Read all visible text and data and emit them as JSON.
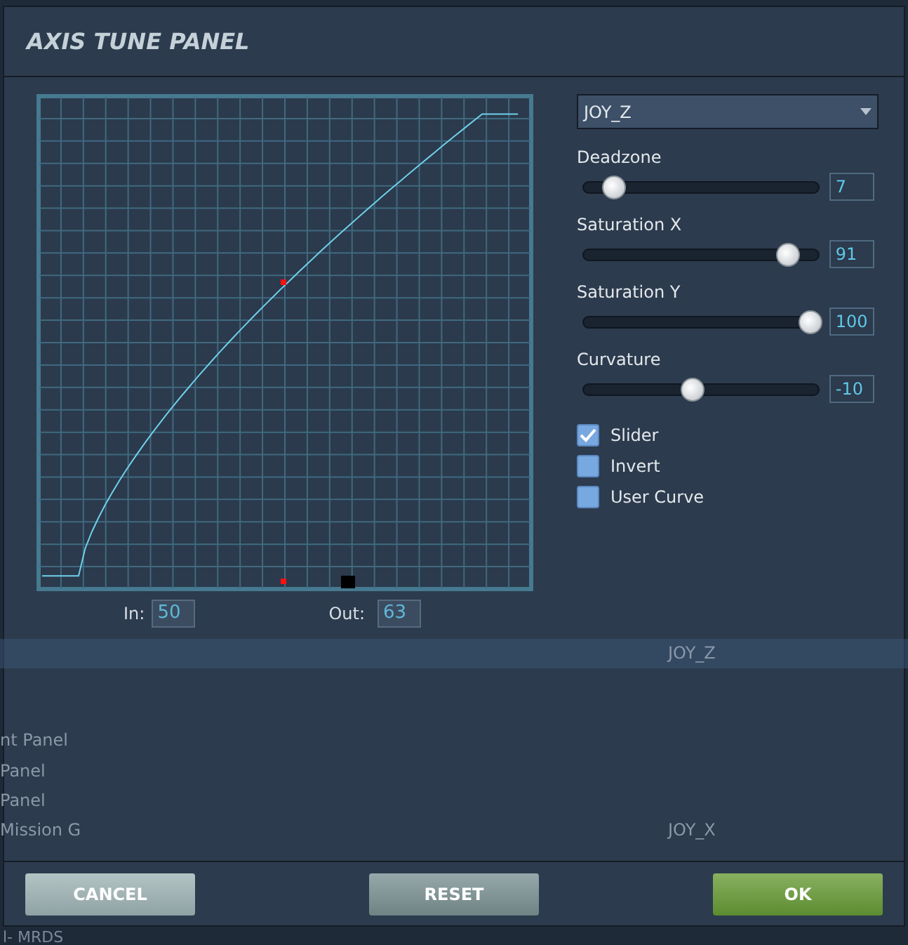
{
  "background": {
    "rows": [
      {
        "left": "",
        "right": "JOY_Z",
        "selected": true
      },
      {
        "left": "nt Panel",
        "right": "",
        "selected": false
      },
      {
        "left": "Panel",
        "right": "",
        "selected": false
      },
      {
        "left": "Panel",
        "right": "",
        "selected": false
      },
      {
        "left": "Mission G",
        "right": "JOY_X",
        "selected": false
      }
    ],
    "below": "l- MRDS"
  },
  "window": {
    "title": "AXIS TUNE PANEL"
  },
  "graph": {
    "in_label": "In:",
    "in_value": "50",
    "out_label": "Out:",
    "out_value": "63"
  },
  "axis_select": {
    "value": "JOY_Z"
  },
  "sliders": [
    {
      "label": "Deadzone",
      "level": 0.1,
      "value": "7"
    },
    {
      "label": "Saturation X",
      "level": 0.88,
      "value": "91"
    },
    {
      "label": "Saturation Y",
      "level": 0.98,
      "value": "100"
    },
    {
      "label": "Curvature",
      "level": 0.45,
      "value": "-10"
    }
  ],
  "checkboxes": [
    {
      "label": "Slider",
      "checked": true
    },
    {
      "label": "Invert",
      "checked": false
    },
    {
      "label": "User Curve",
      "checked": false
    }
  ],
  "buttons": [
    {
      "label": "CANCEL",
      "kind": "cancel"
    },
    {
      "label": "RESET",
      "kind": "reset"
    },
    {
      "label": "OK",
      "kind": "ok"
    }
  ]
}
